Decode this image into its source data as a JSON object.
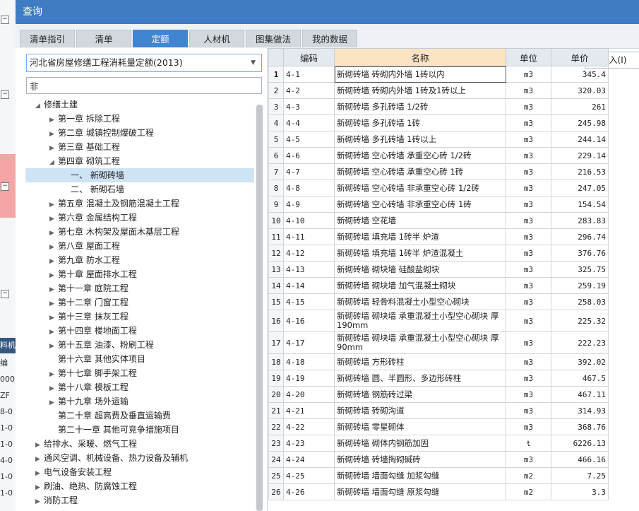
{
  "background_fragments": [
    "料机",
    "编",
    "000",
    "ZF",
    "8-0",
    "1-0",
    "1-0",
    "4-0",
    "1-0",
    "1-0"
  ],
  "dialog": {
    "title": "查询",
    "tabs": [
      "清单指引",
      "清单",
      "定额",
      "人材机",
      "图集做法",
      "我的数据"
    ],
    "active_tab": 2,
    "insert_button": "插入(I)",
    "colors": {
      "title_bar": "#3f7cc4",
      "active_tab": "#3f85d1",
      "header_highlight": "#fbe3c4"
    }
  },
  "left_panel": {
    "library": "河北省房屋修缮工程消耗量定额(2013)",
    "search_value": "非",
    "tree": [
      {
        "label": "修缮土建",
        "level": 0,
        "expanded": true
      },
      {
        "label": "第一章 拆除工程",
        "level": 1
      },
      {
        "label": "第二章 城镇控制爆破工程",
        "level": 1
      },
      {
        "label": "第三章 基础工程",
        "level": 1
      },
      {
        "label": "第四章 砌筑工程",
        "level": 1,
        "expanded": true
      },
      {
        "label": "一、 新砌砖墙",
        "level": 2,
        "selected": true
      },
      {
        "label": "二、 新砌石墙",
        "level": 2
      },
      {
        "label": "第五章 混凝土及钢筋混凝土工程",
        "level": 1
      },
      {
        "label": "第六章 金属结构工程",
        "level": 1
      },
      {
        "label": "第七章 木构架及屋面木基层工程",
        "level": 1
      },
      {
        "label": "第八章 屋面工程",
        "level": 1
      },
      {
        "label": "第九章 防水工程",
        "level": 1
      },
      {
        "label": "第十章 屋面排水工程",
        "level": 1
      },
      {
        "label": "第十一章 庭院工程",
        "level": 1
      },
      {
        "label": "第十二章 门窗工程",
        "level": 1
      },
      {
        "label": "第十三章 抹灰工程",
        "level": 1
      },
      {
        "label": "第十四章 楼地面工程",
        "level": 1
      },
      {
        "label": "第十五章 油漆、粉刷工程",
        "level": 1
      },
      {
        "label": "第十六章 其他实体项目",
        "level": 1,
        "leaf": true
      },
      {
        "label": "第十七章 脚手架工程",
        "level": 1
      },
      {
        "label": "第十八章 模板工程",
        "level": 1
      },
      {
        "label": "第十九章 场外运输",
        "level": 1
      },
      {
        "label": "第二十章 超高费及垂直运输费",
        "level": 1,
        "leaf": true
      },
      {
        "label": "第二十一章 其他可竞争措施项目",
        "level": 1,
        "leaf": true
      },
      {
        "label": "给排水、采暖、燃气工程",
        "level": 0
      },
      {
        "label": "通风空调、机械设备、热力设备及辅机",
        "level": 0
      },
      {
        "label": "电气设备安装工程",
        "level": 0
      },
      {
        "label": "刷油、绝热、防腐蚀工程",
        "level": 0
      },
      {
        "label": "消防工程",
        "level": 0
      }
    ]
  },
  "table": {
    "columns": [
      "编码",
      "名称",
      "单位",
      "单价"
    ],
    "rows": [
      {
        "n": "1",
        "code": "4-1",
        "name": "新砌砖墙 砖砌内外墙 1砖以内",
        "unit": "m3",
        "price": "345.4"
      },
      {
        "n": "2",
        "code": "4-2",
        "name": "新砌砖墙 砖砌内外墙 1砖及1砖以上",
        "unit": "m3",
        "price": "320.03"
      },
      {
        "n": "3",
        "code": "4-3",
        "name": "新砌砖墙 多孔砖墙 1/2砖",
        "unit": "m3",
        "price": "261"
      },
      {
        "n": "4",
        "code": "4-4",
        "name": "新砌砖墙 多孔砖墙 1砖",
        "unit": "m3",
        "price": "245.98"
      },
      {
        "n": "5",
        "code": "4-5",
        "name": "新砌砖墙 多孔砖墙 1砖以上",
        "unit": "m3",
        "price": "244.14"
      },
      {
        "n": "6",
        "code": "4-6",
        "name": "新砌砖墙 空心砖墙 承重空心砖 1/2砖",
        "unit": "m3",
        "price": "229.14"
      },
      {
        "n": "7",
        "code": "4-7",
        "name": "新砌砖墙 空心砖墙 承重空心砖 1砖",
        "unit": "m3",
        "price": "216.53"
      },
      {
        "n": "8",
        "code": "4-8",
        "name": "新砌砖墙 空心砖墙 非承重空心砖 1/2砖",
        "unit": "m3",
        "price": "247.05"
      },
      {
        "n": "9",
        "code": "4-9",
        "name": "新砌砖墙 空心砖墙 非承重空心砖 1砖",
        "unit": "m3",
        "price": "154.54"
      },
      {
        "n": "10",
        "code": "4-10",
        "name": "新砌砖墙 空花墙",
        "unit": "m3",
        "price": "283.83"
      },
      {
        "n": "11",
        "code": "4-11",
        "name": "新砌砖墙 填充墙 1砖半 炉渣",
        "unit": "m3",
        "price": "296.74"
      },
      {
        "n": "12",
        "code": "4-12",
        "name": "新砌砖墙 填充墙 1砖半 炉渣混凝土",
        "unit": "m3",
        "price": "376.76"
      },
      {
        "n": "13",
        "code": "4-13",
        "name": "新砌砖墙 砌块墙 硅酸盐砌块",
        "unit": "m3",
        "price": "325.75"
      },
      {
        "n": "14",
        "code": "4-14",
        "name": "新砌砖墙 砌块墙 加气混凝土砌块",
        "unit": "m3",
        "price": "259.19"
      },
      {
        "n": "15",
        "code": "4-15",
        "name": "新砌砖墙 轻骨料混凝土小型空心砌块",
        "unit": "m3",
        "price": "258.03"
      },
      {
        "n": "16",
        "code": "4-16",
        "name": "新砌砖墙 砌块墙 承重混凝土小型空心砌块 厚190mm",
        "unit": "m3",
        "price": "225.32",
        "tall": true
      },
      {
        "n": "17",
        "code": "4-17",
        "name": "新砌砖墙 砌块墙 承重混凝土小型空心砌块 厚90mm",
        "unit": "m3",
        "price": "222.23",
        "tall": true
      },
      {
        "n": "18",
        "code": "4-18",
        "name": "新砌砖墙 方形砖柱",
        "unit": "m3",
        "price": "392.02"
      },
      {
        "n": "19",
        "code": "4-19",
        "name": "新砌砖墙 圆、半圆形、多边形砖柱",
        "unit": "m3",
        "price": "467.5"
      },
      {
        "n": "20",
        "code": "4-20",
        "name": "新砌砖墙 钢筋砖过梁",
        "unit": "m3",
        "price": "467.11"
      },
      {
        "n": "21",
        "code": "4-21",
        "name": "新砌砖墙 砖砌沟道",
        "unit": "m3",
        "price": "314.93"
      },
      {
        "n": "22",
        "code": "4-22",
        "name": "新砌砖墙 零星砌体",
        "unit": "m3",
        "price": "368.76"
      },
      {
        "n": "23",
        "code": "4-23",
        "name": "新砌砖墙 砌体内钢筋加固",
        "unit": "t",
        "price": "6226.13"
      },
      {
        "n": "24",
        "code": "4-24",
        "name": "新砌砖墙 砖墙掏砌碱砖",
        "unit": "m3",
        "price": "466.16"
      },
      {
        "n": "25",
        "code": "4-25",
        "name": "新砌砖墙 墙面勾缝 加浆勾缝",
        "unit": "m2",
        "price": "7.25"
      },
      {
        "n": "26",
        "code": "4-26",
        "name": "新砌砖墙 墙面勾缝 原浆勾缝",
        "unit": "m2",
        "price": "3.3"
      }
    ]
  }
}
